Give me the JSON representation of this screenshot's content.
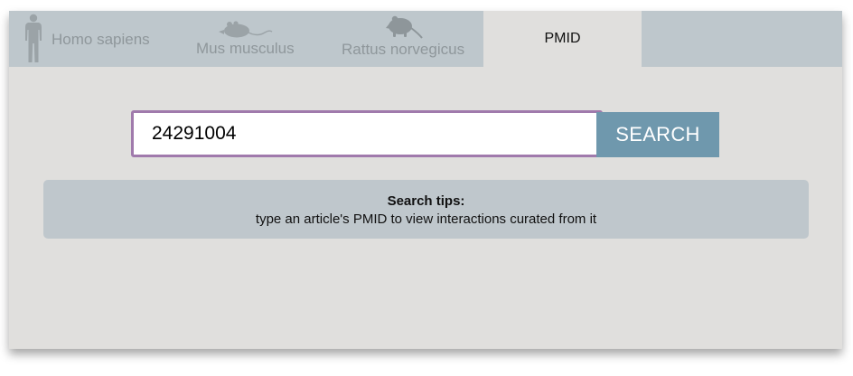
{
  "tabs": {
    "human": {
      "label": "Homo sapiens",
      "icon": "human-silhouette-icon"
    },
    "mouse": {
      "label": "Mus musculus",
      "icon": "mouse-icon"
    },
    "rat": {
      "label": "Rattus norvegicus",
      "icon": "rat-icon"
    },
    "pmid": {
      "label": "PMID",
      "active": true
    }
  },
  "search": {
    "value": "24291004",
    "button_label": "SEARCH"
  },
  "tips": {
    "title": "Search tips:",
    "text": "type an article's PMID to view interactions curated from it"
  },
  "colors": {
    "tabbar": "#bec7cc",
    "panel": "#e0dfdd",
    "input_border": "#a07aac",
    "button": "#6f98ad",
    "tips_box": "#bfc7cc",
    "inactive_tab_text": "#8f979b"
  }
}
